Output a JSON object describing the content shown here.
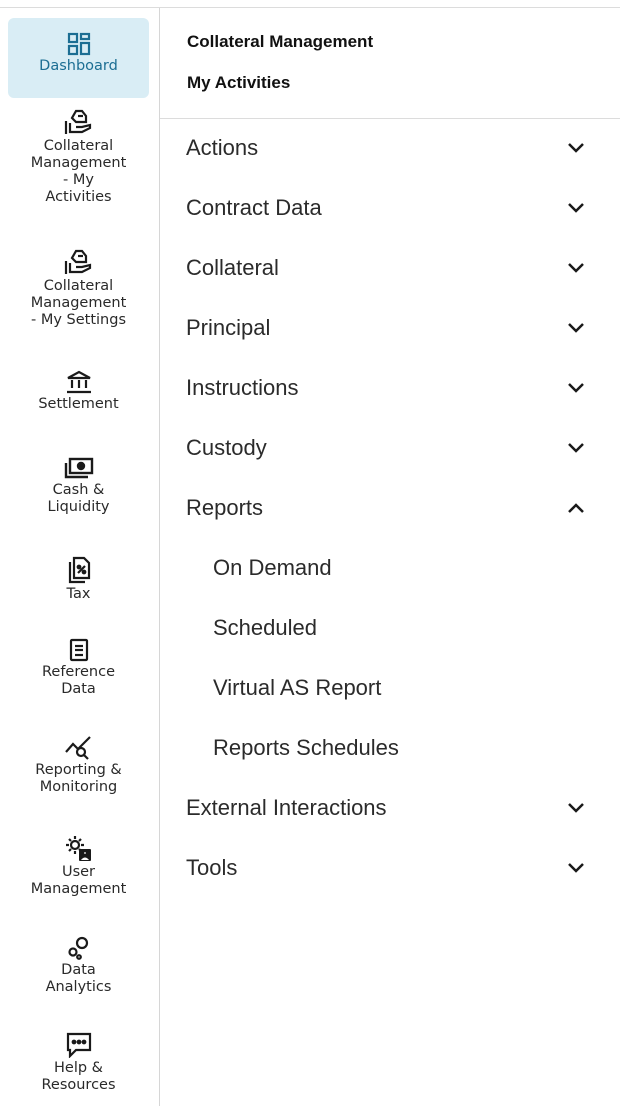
{
  "sidebar": {
    "items": [
      {
        "label": "Dashboard",
        "icon": "dashboard-icon",
        "active": true
      },
      {
        "label": "Collateral\nManagement\n- My\nActivities",
        "icon": "hand-money-icon"
      },
      {
        "label": "Collateral\nManagement\n- My Settings",
        "icon": "hand-money-icon"
      },
      {
        "label": "Settlement",
        "icon": "bank-icon"
      },
      {
        "label": "Cash &\nLiquidity",
        "icon": "cash-icon"
      },
      {
        "label": "Tax",
        "icon": "tax-document-icon"
      },
      {
        "label": "Reference\nData",
        "icon": "document-list-icon"
      },
      {
        "label": "Reporting &\nMonitoring",
        "icon": "chart-search-icon"
      },
      {
        "label": "User\nManagement",
        "icon": "user-gear-icon"
      },
      {
        "label": "Data\nAnalytics",
        "icon": "analytics-circles-icon"
      },
      {
        "label": "Help &\nResources",
        "icon": "chat-bubble-icon"
      }
    ]
  },
  "header": {
    "line1": "Collateral Management",
    "line2": "My Activities"
  },
  "menu": {
    "actions": "Actions",
    "contract_data": "Contract Data",
    "collateral": "Collateral",
    "principal": "Principal",
    "instructions": "Instructions",
    "custody": "Custody",
    "reports": "Reports",
    "reports_sub": {
      "on_demand": "On Demand",
      "scheduled": "Scheduled",
      "virtual_as_report": "Virtual AS Report",
      "reports_schedules": "Reports Schedules"
    },
    "external_interactions": "External Interactions",
    "tools": "Tools"
  },
  "colors": {
    "active_bg": "#d9edf5",
    "active_text": "#1c6e93",
    "icon": "#1a1a1a"
  }
}
